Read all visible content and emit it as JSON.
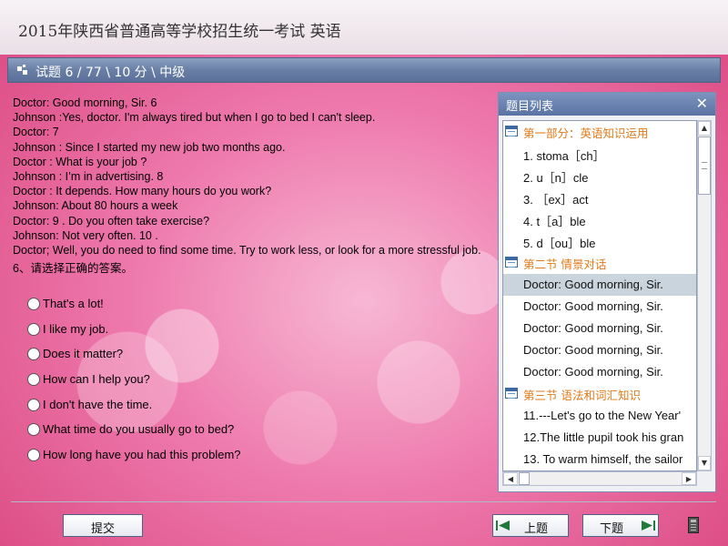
{
  "header": {
    "exam_title": "2015年陕西省普通高等学校招生统一考试 英语"
  },
  "question_bar": {
    "text": "试题 6  /  77 \\ 10 分 \\ 中级"
  },
  "dialogue": [
    "Doctor: Good morning, Sir.        6",
    "Johnson :Yes, doctor.  I'm always tired but when I go to bed I can't sleep.",
    "Doctor:           7",
    "Johnson : Since I started my new job two months ago.",
    "Doctor : What is your job ?",
    "Johnson : I’m in advertising.           8",
    "Doctor : It depends. How many hours do you work?",
    "Johnson: About 80 hours a week",
    "Doctor:          9            . Do you often take exercise?",
    "Johnson: Not very often.          10                  .",
    "Doctor; Well, you do need to find some time.  Try to work less, or look for a more stressful job.",
    "6、请选择正确的答案。"
  ],
  "options": [
    "That's a lot!",
    "I like my job.",
    "Does it matter?",
    "How can I help you?",
    "I don't have the time.",
    "What time do you usually go to bed?",
    "How long have you had this problem?"
  ],
  "panel": {
    "title": "题目列表",
    "close_icon": "close-icon",
    "items": [
      {
        "type": "section",
        "text": "第一部分：英语知识运用"
      },
      {
        "type": "item",
        "text": "1. stoma［ch］"
      },
      {
        "type": "item",
        "text": "2. u［n］cle"
      },
      {
        "type": "item",
        "text": "3. ［ex］act"
      },
      {
        "type": "item",
        "text": "4. t［a］ble"
      },
      {
        "type": "item",
        "text": "5. d［ou］ble"
      },
      {
        "type": "section",
        "text": "第二节 情景对话"
      },
      {
        "type": "item",
        "text": "Doctor: Good morning, Sir.",
        "selected": true
      },
      {
        "type": "item",
        "text": "Doctor: Good morning, Sir."
      },
      {
        "type": "item",
        "text": "Doctor: Good morning, Sir."
      },
      {
        "type": "item",
        "text": "Doctor: Good morning, Sir."
      },
      {
        "type": "item",
        "text": "Doctor: Good morning, Sir."
      },
      {
        "type": "section",
        "text": "第三节 语法和词汇知识"
      },
      {
        "type": "item",
        "text": "11.---Let's go to the New Year'"
      },
      {
        "type": "item",
        "text": "12.The little pupil took his gran"
      },
      {
        "type": "item",
        "text": "13. To warm himself, the sailor"
      }
    ]
  },
  "footer": {
    "submit_label": "提交",
    "prev_label": "上题",
    "next_label": "下题"
  },
  "colors": {
    "section_text": "#e07a1a",
    "header_bar": "#6a7fa6",
    "selected_row": "#c9d4dc"
  }
}
